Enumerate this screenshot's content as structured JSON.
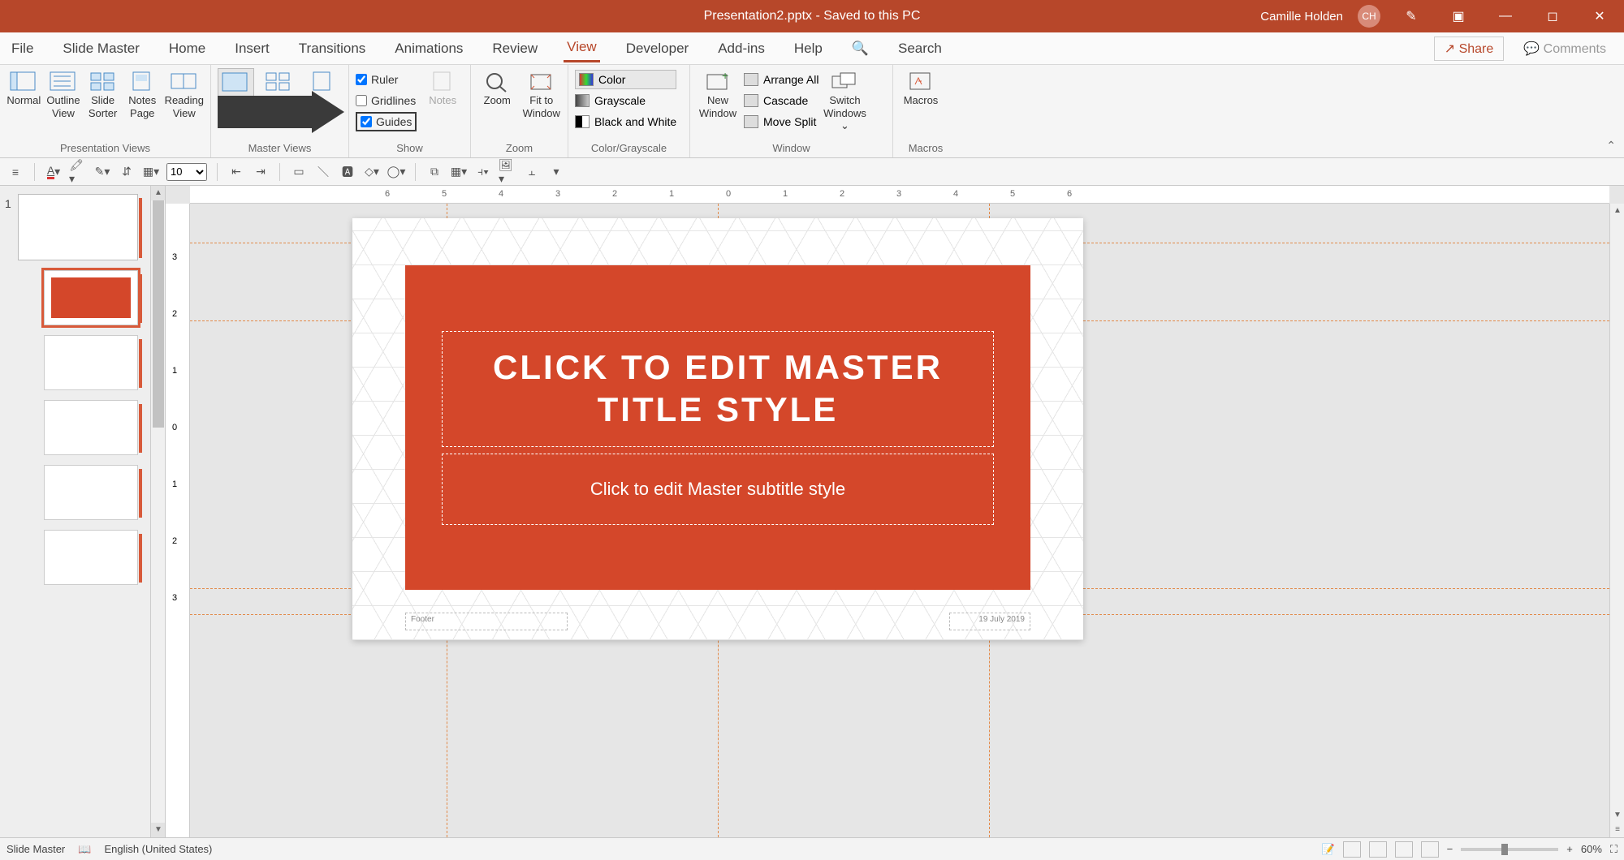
{
  "titlebar": {
    "document": "Presentation2.pptx - Saved to this PC",
    "user_name": "Camille Holden",
    "user_initials": "CH"
  },
  "tabs": {
    "file": "File",
    "slide_master": "Slide Master",
    "home": "Home",
    "insert": "Insert",
    "transitions": "Transitions",
    "animations": "Animations",
    "review": "Review",
    "view": "View",
    "developer": "Developer",
    "addins": "Add-ins",
    "help": "Help",
    "search": "Search"
  },
  "share_label": "Share",
  "comments_label": "Comments",
  "ribbon": {
    "presentation_views": {
      "normal": "Normal",
      "outline": "Outline View",
      "sorter": "Slide Sorter",
      "notes_page": "Notes Page",
      "reading": "Reading View",
      "group": "Presentation Views"
    },
    "master_views": {
      "group": "Master Views"
    },
    "show": {
      "ruler": "Ruler",
      "gridlines": "Gridlines",
      "guides": "Guides",
      "notes": "Notes",
      "group": "Show"
    },
    "zoom": {
      "zoom": "Zoom",
      "fit": "Fit to Window",
      "group": "Zoom"
    },
    "color": {
      "color": "Color",
      "grayscale": "Grayscale",
      "bw": "Black and White",
      "group": "Color/Grayscale"
    },
    "window": {
      "new_window": "New Window",
      "arrange": "Arrange All",
      "cascade": "Cascade",
      "move_split": "Move Split",
      "switch": "Switch Windows",
      "group": "Window"
    },
    "macros": {
      "macros": "Macros",
      "group": "Macros"
    }
  },
  "qat": {
    "font_size": "10"
  },
  "slide": {
    "number": "1",
    "title_placeholder": "Click to edit Master title style",
    "subtitle_placeholder": "Click to edit Master subtitle style",
    "footer_label": "Footer",
    "date_label": "19 July 2019"
  },
  "ruler_h": [
    "6",
    "5",
    "4",
    "3",
    "2",
    "1",
    "0",
    "1",
    "2",
    "3",
    "4",
    "5",
    "6"
  ],
  "ruler_v": [
    "3",
    "2",
    "1",
    "0",
    "1",
    "2",
    "3"
  ],
  "statusbar": {
    "mode": "Slide Master",
    "language": "English (United States)",
    "zoom": "60%"
  }
}
